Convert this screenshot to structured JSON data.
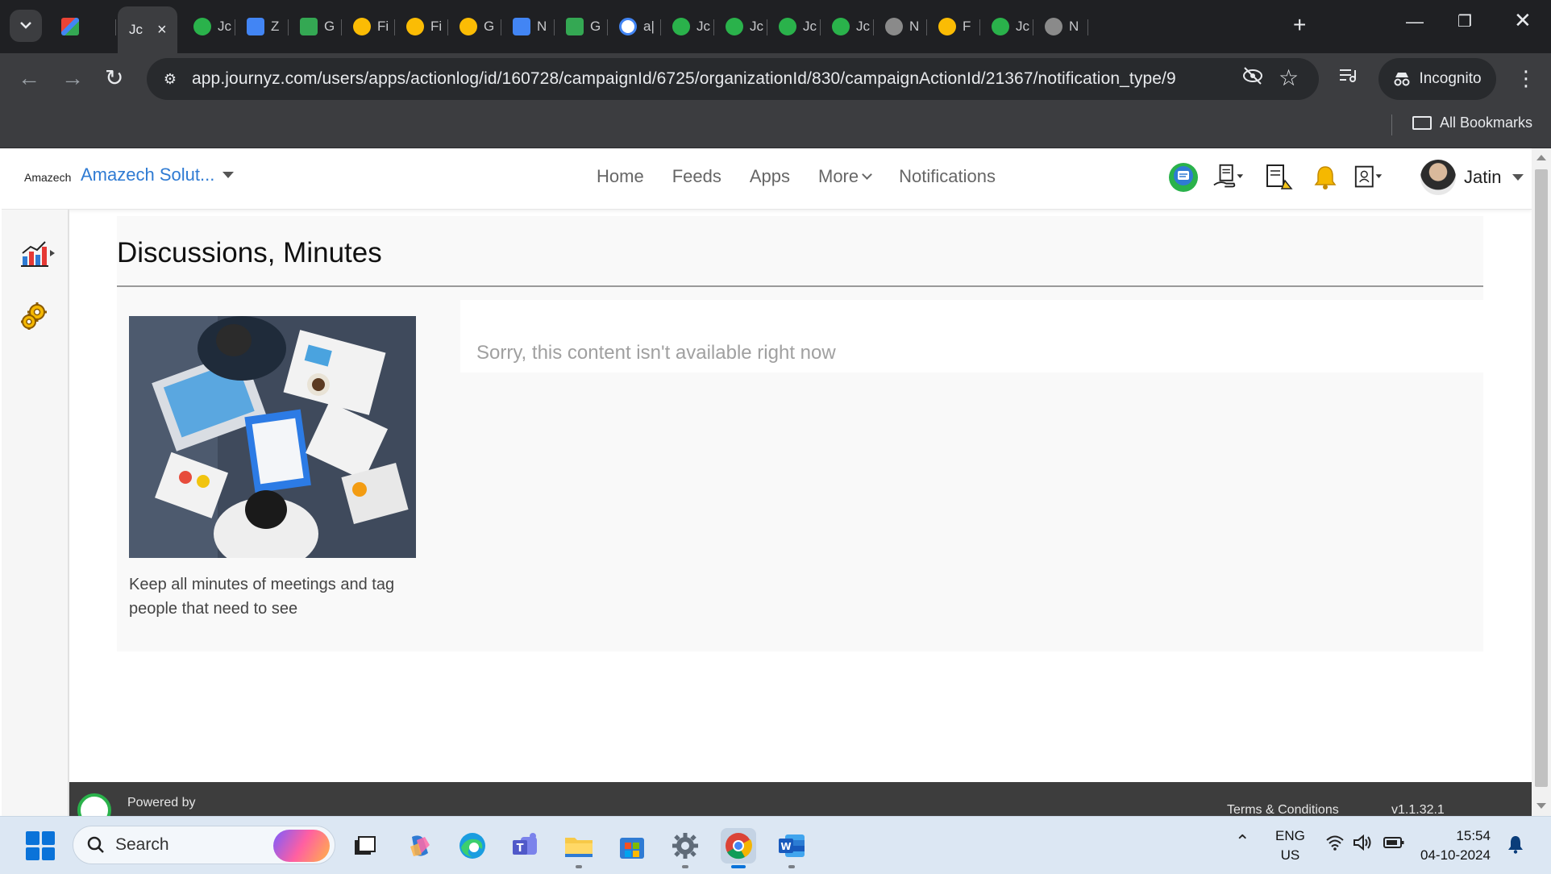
{
  "browser": {
    "tabs": [
      {
        "label": "",
        "favicon_color": "#ea4335",
        "icon": "gmail-icon"
      },
      {
        "label": "Jc",
        "favicon_color": "#3c3d40",
        "icon": "journyz-icon",
        "active": true
      },
      {
        "label": "Jc",
        "favicon_color": "#2ab24b",
        "icon": "journyz-icon"
      },
      {
        "label": "Z",
        "favicon_color": "#4285f4",
        "icon": "calendar-icon"
      },
      {
        "label": "G",
        "favicon_color": "#34a853",
        "icon": "meet-icon"
      },
      {
        "label": "Fi",
        "favicon_color": "#fbbc04",
        "icon": "drive-icon"
      },
      {
        "label": "Fi",
        "favicon_color": "#fbbc04",
        "icon": "drive-icon"
      },
      {
        "label": "G",
        "favicon_color": "#fbbc04",
        "icon": "drive-icon"
      },
      {
        "label": "N",
        "favicon_color": "#4285f4",
        "icon": "docs-icon"
      },
      {
        "label": "G",
        "favicon_color": "#34a853",
        "icon": "meet-icon"
      },
      {
        "label": "a|",
        "favicon_color": "#ffffff",
        "icon": "google-icon"
      },
      {
        "label": "Jc",
        "favicon_color": "#2ab24b",
        "icon": "journyz-icon"
      },
      {
        "label": "Jc",
        "favicon_color": "#2ab24b",
        "icon": "journyz-icon"
      },
      {
        "label": "Jc",
        "favicon_color": "#2ab24b",
        "icon": "journyz-icon"
      },
      {
        "label": "Jc",
        "favicon_color": "#2ab24b",
        "icon": "journyz-icon"
      },
      {
        "label": "N",
        "favicon_color": "#8a8a8a",
        "icon": "globe-icon"
      },
      {
        "label": "F",
        "favicon_color": "#fbbc04",
        "icon": "drive-icon"
      },
      {
        "label": "Jc",
        "favicon_color": "#2ab24b",
        "icon": "journyz-icon"
      },
      {
        "label": "N",
        "favicon_color": "#8a8a8a",
        "icon": "incognito-icon"
      }
    ],
    "url": "app.journyz.com/users/apps/actionlog/id/160728/campaignId/6725/organizationId/830/campaignActionId/21367/notification_type/9",
    "incognito_label": "Incognito",
    "all_bookmarks_label": "All Bookmarks"
  },
  "header": {
    "org_small": "Amazech",
    "org_name": "Amazech Solut...",
    "nav": {
      "home": "Home",
      "feeds": "Feeds",
      "apps": "Apps",
      "more": "More",
      "notifications": "Notifications"
    },
    "user_name": "Jatin"
  },
  "page": {
    "title": "Discussions, Minutes",
    "description": "Keep all minutes of meetings and tag people that need to see",
    "notice": "Sorry, this content isn't available right now"
  },
  "footer": {
    "powered_by": "Powered by",
    "terms": "Terms & Conditions",
    "version": "v1.1.32.1"
  },
  "taskbar": {
    "search_placeholder": "Search",
    "lang_top": "ENG",
    "lang_bottom": "US",
    "time": "15:54",
    "date": "04-10-2024"
  },
  "colors": {
    "accent": "#2f7bd3",
    "brand_green": "#2ab24b",
    "chrome_dark": "#1f2023"
  }
}
